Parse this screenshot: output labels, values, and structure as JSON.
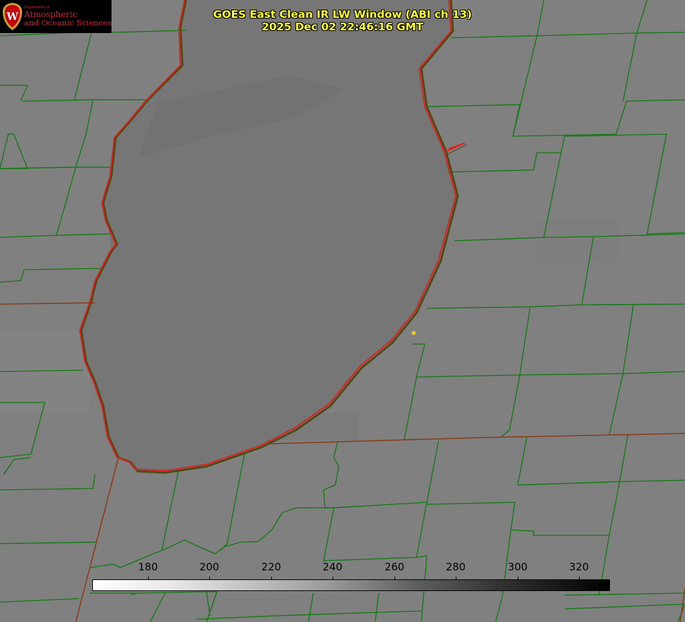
{
  "header": {
    "title_line1": "GOES East Clean IR LW Window (ABI ch 13)",
    "title_line2": "2025 Dec 02 22:46:16 GMT"
  },
  "logo": {
    "dept_text": "Department of",
    "org_line1": "Atmospheric",
    "org_line2": "and Oceanic Sciences",
    "seal_letter": "W"
  },
  "colorbar": {
    "tick_labels": [
      "180",
      "200",
      "220",
      "240",
      "260",
      "280",
      "300",
      "320"
    ],
    "range_start": "white",
    "range_end": "black"
  },
  "colors": {
    "background": "#808080",
    "lake": "#767676",
    "county_lines": "#0d7a0d",
    "state_lines": "#8b3a1a",
    "shoreline": "#e0221d",
    "title_text": "#ffff2a",
    "logo_red": "#d61d3a",
    "marker": "#e3cc22"
  },
  "icons": {
    "seal": "university-seal-icon",
    "marker": "location-dot-icon"
  }
}
